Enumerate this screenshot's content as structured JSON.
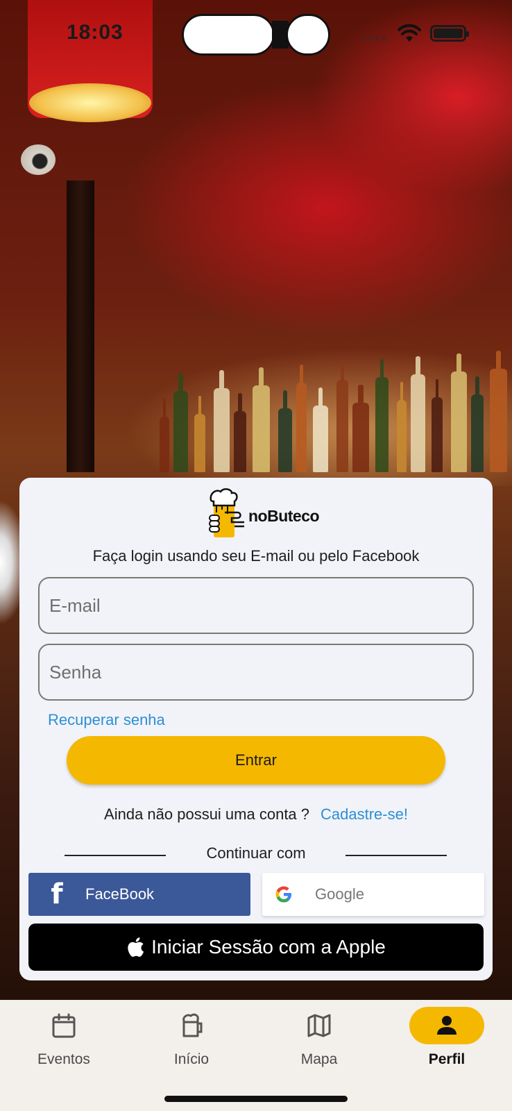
{
  "status_bar": {
    "time": "18:03"
  },
  "brand": {
    "logo_text": "noButeco",
    "accent_color": "#f5b800"
  },
  "login": {
    "subtitle": "Faça login usando seu E-mail ou pelo Facebook",
    "email_placeholder": "E-mail",
    "password_placeholder": "Senha",
    "recover_label": "Recuperar senha",
    "submit_label": "Entrar",
    "signup_prompt": "Ainda não possui uma conta ?",
    "signup_link": "Cadastre-se!",
    "continue_with": "Continuar com",
    "facebook_label": "FaceBook",
    "google_label": "Google",
    "apple_label": "Iniciar Sessão com a Apple",
    "link_color": "#2b8fd6",
    "facebook_color": "#3b5898"
  },
  "nav": {
    "items": [
      {
        "label": "Eventos",
        "icon": "calendar-icon",
        "active": false
      },
      {
        "label": "Início",
        "icon": "beer-mug-icon",
        "active": false
      },
      {
        "label": "Mapa",
        "icon": "map-icon",
        "active": false
      },
      {
        "label": "Perfil",
        "icon": "person-icon",
        "active": true
      }
    ]
  }
}
